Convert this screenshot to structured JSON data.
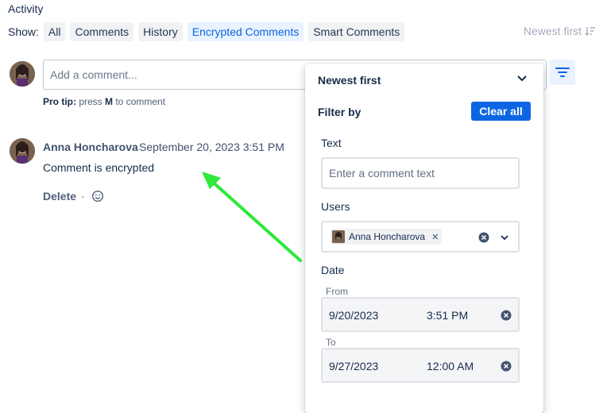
{
  "activity": {
    "heading": "Activity",
    "show_label": "Show:",
    "tabs": [
      {
        "label": "All"
      },
      {
        "label": "Comments"
      },
      {
        "label": "History"
      },
      {
        "label": "Encrypted Comments"
      },
      {
        "label": "Smart Comments"
      }
    ],
    "active_tab": "Encrypted Comments",
    "sort_label": "Newest first"
  },
  "composer": {
    "placeholder": "Add a comment...",
    "pro_tip_prefix": "Pro tip:",
    "pro_tip_text": " press ",
    "pro_tip_key": "M",
    "pro_tip_suffix": " to comment"
  },
  "comment": {
    "author": "Anna Honcharova",
    "date": "September 20, 2023 3:51 PM",
    "body": "Comment is encrypted",
    "delete_label": "Delete",
    "separator": "·"
  },
  "filter_panel": {
    "sort_value": "Newest first",
    "filter_by": "Filter by",
    "clear_all": "Clear all",
    "text_label": "Text",
    "text_placeholder": "Enter a comment text",
    "users_label": "Users",
    "selected_user": "Anna Honcharova",
    "date_label": "Date",
    "from_label": "From",
    "from_date": "9/20/2023",
    "from_time": "3:51 PM",
    "to_label": "To",
    "to_date": "9/27/2023",
    "to_time": "12:00 AM"
  },
  "colors": {
    "accent": "#0c66e4",
    "annotation_arrow": "#2ee83a"
  }
}
